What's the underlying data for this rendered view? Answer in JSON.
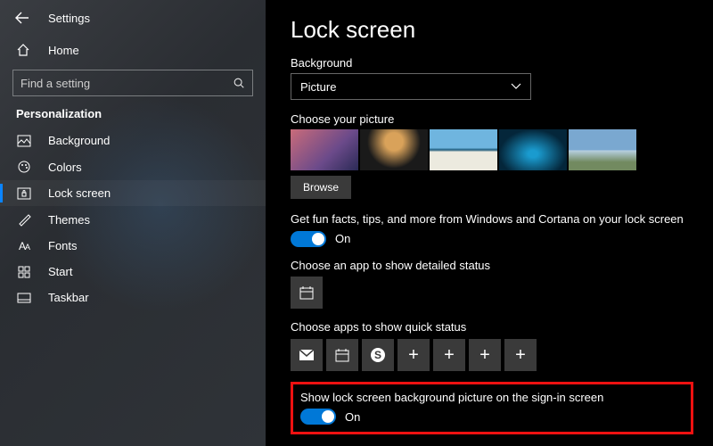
{
  "window": {
    "title": "Settings"
  },
  "sidebar": {
    "home": "Home",
    "search_placeholder": "Find a setting",
    "section": "Personalization",
    "items": [
      {
        "label": "Background",
        "icon": "image-icon"
      },
      {
        "label": "Colors",
        "icon": "palette-icon"
      },
      {
        "label": "Lock screen",
        "icon": "lock-icon"
      },
      {
        "label": "Themes",
        "icon": "brush-icon"
      },
      {
        "label": "Fonts",
        "icon": "font-icon"
      },
      {
        "label": "Start",
        "icon": "start-icon"
      },
      {
        "label": "Taskbar",
        "icon": "taskbar-icon"
      }
    ],
    "active_index": 2
  },
  "main": {
    "title": "Lock screen",
    "background_label": "Background",
    "background_value": "Picture",
    "choose_picture_label": "Choose your picture",
    "browse": "Browse",
    "fun_facts": {
      "label": "Get fun facts, tips, and more from Windows and Cortana on your lock screen",
      "state": "On"
    },
    "detailed_status_label": "Choose an app to show detailed status",
    "detailed_status_app": "calendar-icon",
    "quick_status_label": "Choose apps to show quick status",
    "quick_status_apps": [
      "mail-icon",
      "calendar-icon",
      "skype-icon",
      "add",
      "add",
      "add",
      "add"
    ],
    "signin_bg": {
      "label": "Show lock screen background picture on the sign-in screen",
      "state": "On"
    }
  }
}
